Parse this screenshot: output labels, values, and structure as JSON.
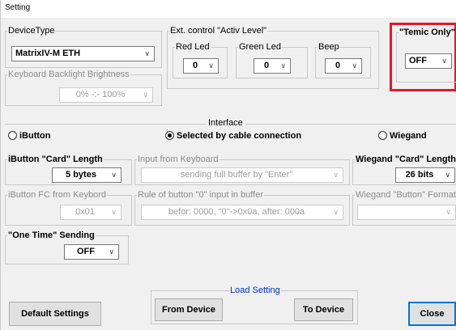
{
  "window": {
    "title": "Setting"
  },
  "device_type": {
    "legend": "DeviceType",
    "value": "MatrixIV-M ETH"
  },
  "backlight": {
    "legend": "Keyboard Backlight Brightness",
    "value": "0% -:- 100%"
  },
  "ext_control": {
    "legend": "Ext. control  \"Activ Level\"",
    "red_led": {
      "legend": "Red Led",
      "value": "0"
    },
    "green_led": {
      "legend": "Green Led",
      "value": "0"
    },
    "beep": {
      "legend": "Beep",
      "value": "0"
    }
  },
  "temic": {
    "legend": "\"Temic Only\"",
    "value": "OFF"
  },
  "interface": {
    "legend": "Interface",
    "ibutton": "iButton",
    "cable": "Selected by cable connection",
    "wiegand": "Wiegand",
    "selected": "cable"
  },
  "ibutton_card_length": {
    "legend": "iButton \"Card\" Length",
    "value": "5 bytes"
  },
  "input_from_keyboard": {
    "legend": "Input from Keyboard",
    "value": "sending full buffer by \"Enter\""
  },
  "wiegand_card_length": {
    "legend": "Wiegand \"Card\" Length",
    "value": "26 bits"
  },
  "ibutton_fc": {
    "legend": "iButton FC from Keybord",
    "value": "0x01"
  },
  "rule_button_0": {
    "legend": "Rule of button \"0\" input in buffer",
    "value": "befor: 0000, \"0\"->0x0a, after: 000a"
  },
  "wiegand_button_format": {
    "legend": "Wiegand \"Button\" Format",
    "value": ""
  },
  "one_time": {
    "legend": "\"One Time\" Sending",
    "value": "OFF"
  },
  "load_setting": {
    "legend": "Load Setting",
    "from_device": "From Device",
    "to_device": "To Device"
  },
  "buttons": {
    "default_settings": "Default Settings",
    "close": "Close"
  },
  "colors": {
    "highlight": "#e0192d",
    "load_legend": "#0033cc",
    "focus_border": "#0078d7"
  }
}
